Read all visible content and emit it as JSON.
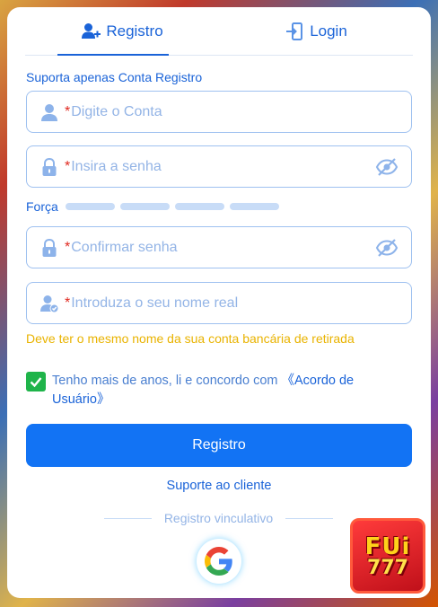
{
  "tabs": {
    "register": {
      "label": "Registro",
      "icon": "user-plus-icon"
    },
    "login": {
      "label": "Login",
      "icon": "login-door-icon"
    }
  },
  "form": {
    "section_label": "Suporta apenas Conta Registro",
    "account": {
      "required_mark": "*",
      "placeholder": "Digite o Conta",
      "icon": "user-icon"
    },
    "password": {
      "required_mark": "*",
      "placeholder": "Insira a senha",
      "icon": "lock-icon"
    },
    "strength": {
      "label": "Força",
      "segments": 4,
      "filled": 0
    },
    "confirm": {
      "required_mark": "*",
      "placeholder": "Confirmar senha",
      "icon": "lock-icon"
    },
    "real_name": {
      "required_mark": "*",
      "placeholder": "Introduza o seu nome real",
      "icon": "user-verified-icon"
    },
    "real_name_hint": "Deve ter o mesmo nome da sua conta bancária de retirada",
    "agreement": {
      "checked": true,
      "text": "Tenho mais de anos, li e concordo com ",
      "link": "《Acordo de Usuário》"
    },
    "submit_label": "Registro"
  },
  "support_link": "Suporte ao cliente",
  "bind_divider": "Registro vinculativo",
  "social": {
    "google_icon": "google-icon"
  },
  "brand_logo": {
    "line1": "FUi",
    "line2": "777"
  },
  "colors": {
    "accent": "#1a63d8",
    "button": "#1273f4",
    "warning": "#e9b300",
    "checkbox": "#1fb44a",
    "required": "#e0281f"
  }
}
